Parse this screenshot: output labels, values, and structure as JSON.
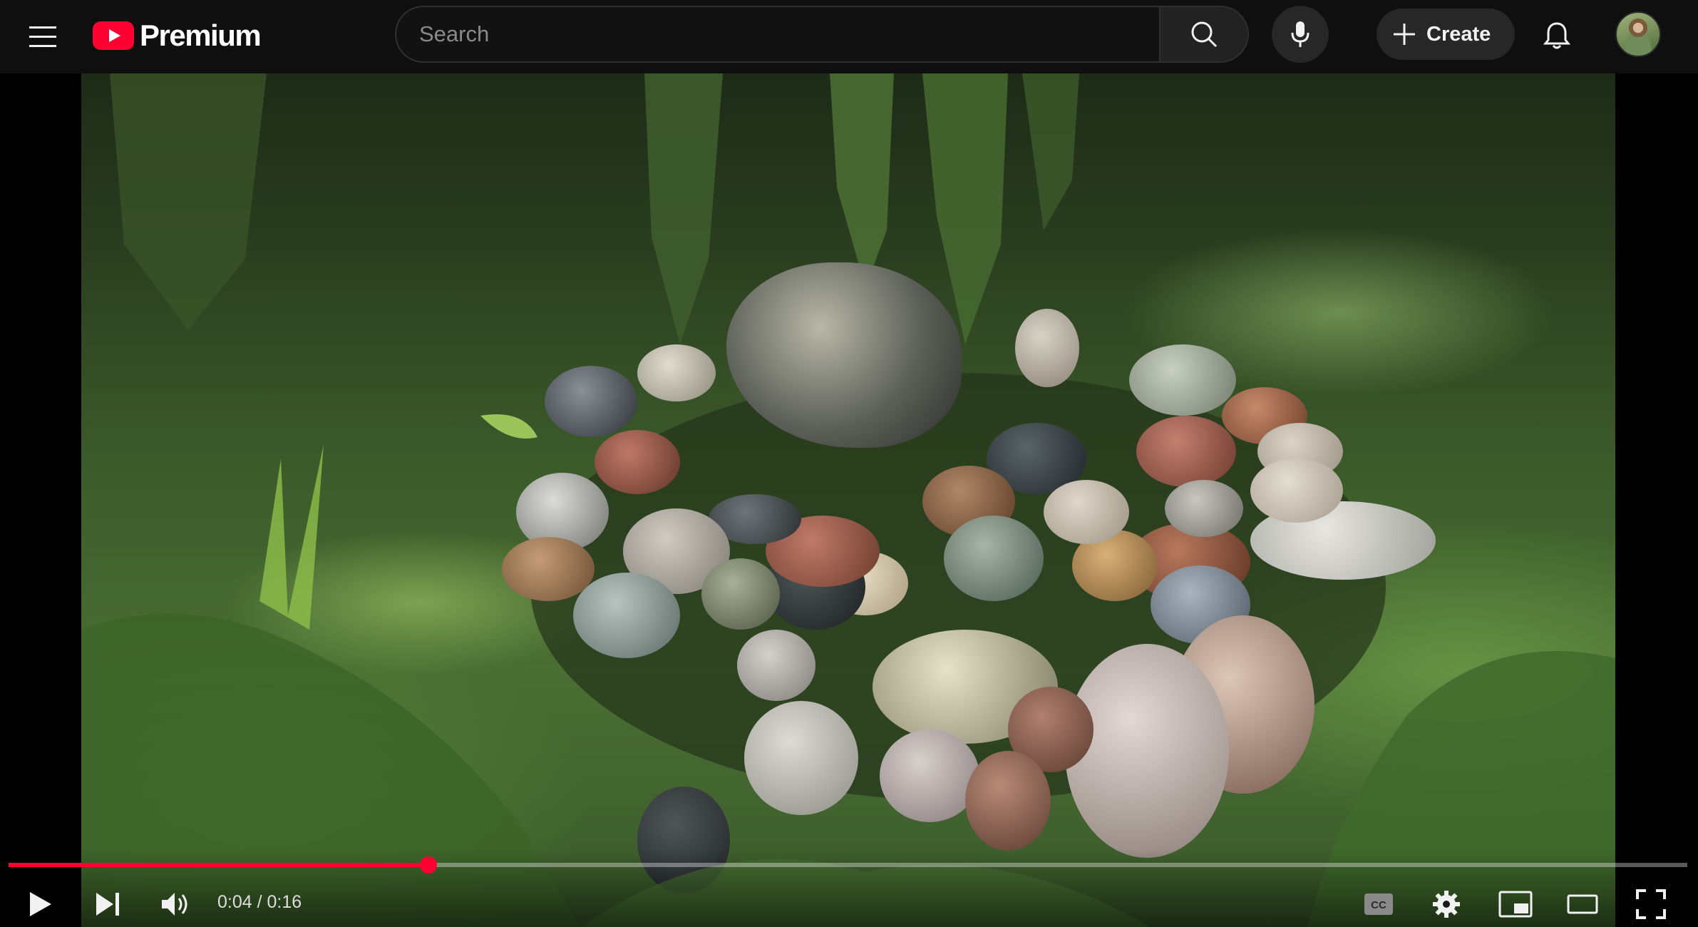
{
  "header": {
    "logo_text": "Premium",
    "search_placeholder": "Search",
    "create_label": "Create"
  },
  "player": {
    "current_time": "0:04",
    "duration": "0:16",
    "time_separator": "/",
    "progress_fraction": 0.25
  },
  "colors": {
    "accent": "#ff0033",
    "background": "#0f0f0f",
    "button_bg": "#272727"
  },
  "icons": [
    "menu-icon",
    "youtube-logo-icon",
    "search-icon",
    "microphone-icon",
    "plus-icon",
    "bell-icon",
    "play-icon",
    "next-icon",
    "volume-icon",
    "captions-icon",
    "settings-icon",
    "miniplayer-icon",
    "theater-icon",
    "fullscreen-icon"
  ]
}
